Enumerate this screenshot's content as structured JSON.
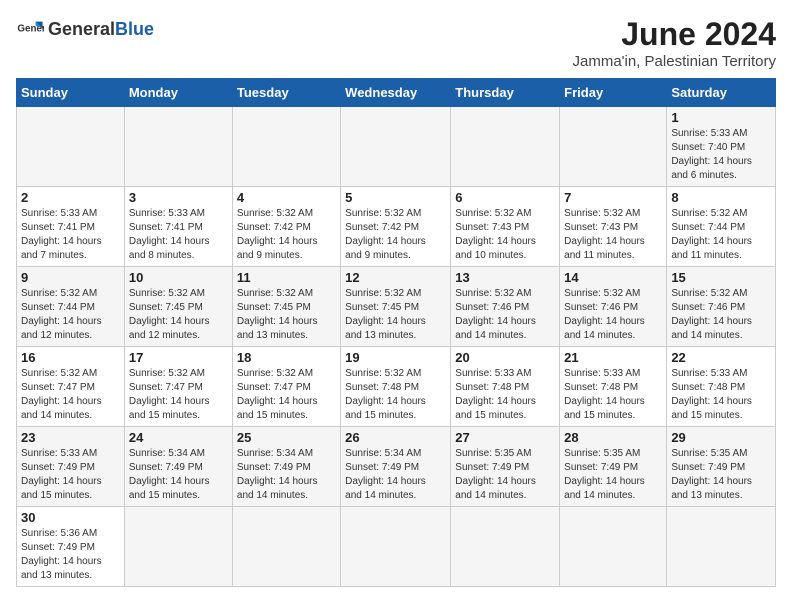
{
  "header": {
    "logo_general": "General",
    "logo_blue": "Blue",
    "month_year": "June 2024",
    "location": "Jamma'in, Palestinian Territory"
  },
  "days_of_week": [
    "Sunday",
    "Monday",
    "Tuesday",
    "Wednesday",
    "Thursday",
    "Friday",
    "Saturday"
  ],
  "weeks": [
    [
      {
        "day": "",
        "info": ""
      },
      {
        "day": "",
        "info": ""
      },
      {
        "day": "",
        "info": ""
      },
      {
        "day": "",
        "info": ""
      },
      {
        "day": "",
        "info": ""
      },
      {
        "day": "",
        "info": ""
      },
      {
        "day": "1",
        "info": "Sunrise: 5:33 AM\nSunset: 7:40 PM\nDaylight: 14 hours\nand 6 minutes."
      }
    ],
    [
      {
        "day": "2",
        "info": "Sunrise: 5:33 AM\nSunset: 7:41 PM\nDaylight: 14 hours\nand 7 minutes."
      },
      {
        "day": "3",
        "info": "Sunrise: 5:33 AM\nSunset: 7:41 PM\nDaylight: 14 hours\nand 8 minutes."
      },
      {
        "day": "4",
        "info": "Sunrise: 5:32 AM\nSunset: 7:42 PM\nDaylight: 14 hours\nand 9 minutes."
      },
      {
        "day": "5",
        "info": "Sunrise: 5:32 AM\nSunset: 7:42 PM\nDaylight: 14 hours\nand 9 minutes."
      },
      {
        "day": "6",
        "info": "Sunrise: 5:32 AM\nSunset: 7:43 PM\nDaylight: 14 hours\nand 10 minutes."
      },
      {
        "day": "7",
        "info": "Sunrise: 5:32 AM\nSunset: 7:43 PM\nDaylight: 14 hours\nand 11 minutes."
      },
      {
        "day": "8",
        "info": "Sunrise: 5:32 AM\nSunset: 7:44 PM\nDaylight: 14 hours\nand 11 minutes."
      }
    ],
    [
      {
        "day": "9",
        "info": "Sunrise: 5:32 AM\nSunset: 7:44 PM\nDaylight: 14 hours\nand 12 minutes."
      },
      {
        "day": "10",
        "info": "Sunrise: 5:32 AM\nSunset: 7:45 PM\nDaylight: 14 hours\nand 12 minutes."
      },
      {
        "day": "11",
        "info": "Sunrise: 5:32 AM\nSunset: 7:45 PM\nDaylight: 14 hours\nand 13 minutes."
      },
      {
        "day": "12",
        "info": "Sunrise: 5:32 AM\nSunset: 7:45 PM\nDaylight: 14 hours\nand 13 minutes."
      },
      {
        "day": "13",
        "info": "Sunrise: 5:32 AM\nSunset: 7:46 PM\nDaylight: 14 hours\nand 14 minutes."
      },
      {
        "day": "14",
        "info": "Sunrise: 5:32 AM\nSunset: 7:46 PM\nDaylight: 14 hours\nand 14 minutes."
      },
      {
        "day": "15",
        "info": "Sunrise: 5:32 AM\nSunset: 7:46 PM\nDaylight: 14 hours\nand 14 minutes."
      }
    ],
    [
      {
        "day": "16",
        "info": "Sunrise: 5:32 AM\nSunset: 7:47 PM\nDaylight: 14 hours\nand 14 minutes."
      },
      {
        "day": "17",
        "info": "Sunrise: 5:32 AM\nSunset: 7:47 PM\nDaylight: 14 hours\nand 15 minutes."
      },
      {
        "day": "18",
        "info": "Sunrise: 5:32 AM\nSunset: 7:47 PM\nDaylight: 14 hours\nand 15 minutes."
      },
      {
        "day": "19",
        "info": "Sunrise: 5:32 AM\nSunset: 7:48 PM\nDaylight: 14 hours\nand 15 minutes."
      },
      {
        "day": "20",
        "info": "Sunrise: 5:33 AM\nSunset: 7:48 PM\nDaylight: 14 hours\nand 15 minutes."
      },
      {
        "day": "21",
        "info": "Sunrise: 5:33 AM\nSunset: 7:48 PM\nDaylight: 14 hours\nand 15 minutes."
      },
      {
        "day": "22",
        "info": "Sunrise: 5:33 AM\nSunset: 7:48 PM\nDaylight: 14 hours\nand 15 minutes."
      }
    ],
    [
      {
        "day": "23",
        "info": "Sunrise: 5:33 AM\nSunset: 7:49 PM\nDaylight: 14 hours\nand 15 minutes."
      },
      {
        "day": "24",
        "info": "Sunrise: 5:34 AM\nSunset: 7:49 PM\nDaylight: 14 hours\nand 15 minutes."
      },
      {
        "day": "25",
        "info": "Sunrise: 5:34 AM\nSunset: 7:49 PM\nDaylight: 14 hours\nand 14 minutes."
      },
      {
        "day": "26",
        "info": "Sunrise: 5:34 AM\nSunset: 7:49 PM\nDaylight: 14 hours\nand 14 minutes."
      },
      {
        "day": "27",
        "info": "Sunrise: 5:35 AM\nSunset: 7:49 PM\nDaylight: 14 hours\nand 14 minutes."
      },
      {
        "day": "28",
        "info": "Sunrise: 5:35 AM\nSunset: 7:49 PM\nDaylight: 14 hours\nand 14 minutes."
      },
      {
        "day": "29",
        "info": "Sunrise: 5:35 AM\nSunset: 7:49 PM\nDaylight: 14 hours\nand 13 minutes."
      }
    ],
    [
      {
        "day": "30",
        "info": "Sunrise: 5:36 AM\nSunset: 7:49 PM\nDaylight: 14 hours\nand 13 minutes."
      },
      {
        "day": "",
        "info": ""
      },
      {
        "day": "",
        "info": ""
      },
      {
        "day": "",
        "info": ""
      },
      {
        "day": "",
        "info": ""
      },
      {
        "day": "",
        "info": ""
      },
      {
        "day": "",
        "info": ""
      }
    ]
  ]
}
